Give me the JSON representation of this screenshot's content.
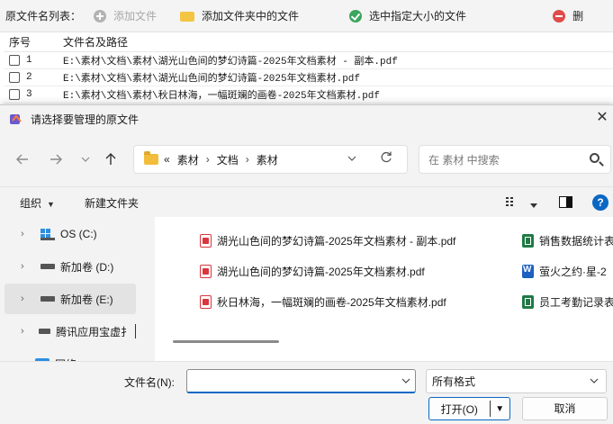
{
  "app": {
    "toolbar": {
      "list_label": "原文件名列表：",
      "add_file": "添加文件",
      "add_folder_files": "添加文件夹中的文件",
      "select_by_size": "选中指定大小的文件",
      "remove_partial": "删"
    },
    "table": {
      "headers": {
        "num": "序号",
        "path": "文件名及路径"
      },
      "rows": [
        {
          "num": "1",
          "path": "E:\\素材\\文档\\素材\\湖光山色间的梦幻诗篇-2025年文档素材 - 副本.pdf"
        },
        {
          "num": "2",
          "path": "E:\\素材\\文档\\素材\\湖光山色间的梦幻诗篇-2025年文档素材.pdf"
        },
        {
          "num": "3",
          "path": "E:\\素材\\文档\\素材\\秋日林海，一幅斑斓的画卷-2025年文档素材.pdf"
        }
      ]
    }
  },
  "dialog": {
    "title": "请选择要管理的原文件",
    "close_glyph": "✕",
    "address": {
      "prefix": "«",
      "crumbs": [
        "素材",
        "文档",
        "素材"
      ],
      "separator": "›"
    },
    "search": {
      "placeholder": "在 素材 中搜索"
    },
    "commands": {
      "organize": "组织",
      "new_folder": "新建文件夹",
      "help": "?"
    },
    "nav_items": [
      {
        "label": "OS (C:)"
      },
      {
        "label": "新加卷 (D:)"
      },
      {
        "label": "新加卷 (E:)"
      },
      {
        "label": "腾讯应用宝虚扌"
      },
      {
        "label": "网络"
      }
    ],
    "files_left": [
      "湖光山色间的梦幻诗篇-2025年文档素材 - 副本.pdf",
      "湖光山色间的梦幻诗篇-2025年文档素材.pdf",
      "秋日林海，一幅斑斓的画卷-2025年文档素材.pdf"
    ],
    "files_right": [
      "销售数据统计表",
      "萤火之约·星-2",
      "员工考勤记录表"
    ],
    "filename": {
      "label": "文件名(N):",
      "value": ""
    },
    "filetype": {
      "value": "所有格式"
    },
    "buttons": {
      "open": "打开(O)",
      "cancel": "取消"
    }
  },
  "colors": {
    "accent": "#0a67c4",
    "pdf_red": "#d9363e",
    "xls_green": "#1f7a45",
    "doc_blue": "#1e5fc2"
  }
}
